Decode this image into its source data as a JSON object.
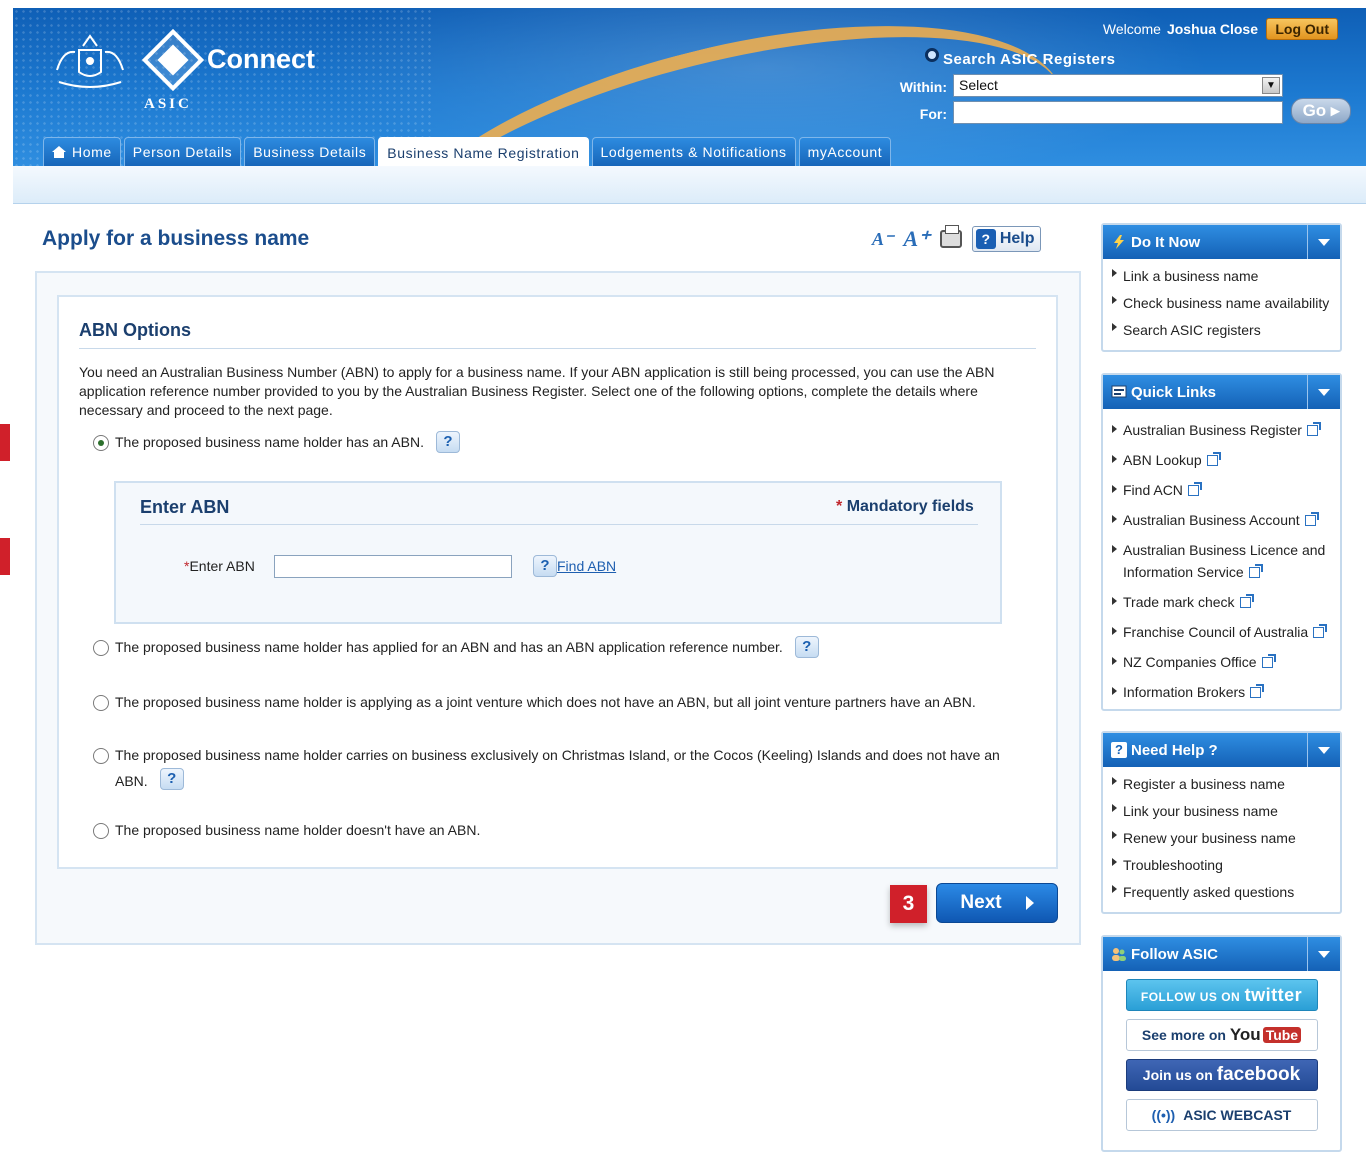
{
  "brand": {
    "name": "Connect",
    "sub": "ASIC"
  },
  "header": {
    "welcome_label": "Welcome",
    "user_name": "Joshua Close",
    "logout_label": "Log Out",
    "search_title": "Search ASIC Registers",
    "within_label": "Within:",
    "within_value": "Select",
    "for_label": "For:",
    "go_label": "Go"
  },
  "tabs": [
    {
      "label": "Home",
      "active": false
    },
    {
      "label": "Person Details",
      "active": false
    },
    {
      "label": "Business Details",
      "active": false
    },
    {
      "label": "Business Name Registration",
      "active": true
    },
    {
      "label": "Lodgements & Notifications",
      "active": false
    },
    {
      "label": "myAccount",
      "active": false
    }
  ],
  "main": {
    "page_title": "Apply for a business name",
    "help_label": "Help",
    "section_title": "ABN Options",
    "intro": "You need an Australian Business Number (ABN) to apply for a business name. If your ABN application is still being processed, you can use the ABN application reference number provided to you by the Australian Business Register. Select one of the following options, complete the details where necessary and proceed to the next page.",
    "options": [
      {
        "label": "The proposed business name holder has an ABN.",
        "checked": true
      },
      {
        "label": "The proposed business name holder has applied for an ABN and has an ABN application reference number.",
        "checked": false
      },
      {
        "label": "The proposed business name holder is applying as a joint venture which does not have an ABN, but all joint venture partners have an ABN.",
        "checked": false
      },
      {
        "label": "The proposed business name holder carries on business exclusively on Christmas Island, or the Cocos (Keeling) Islands and does not have an ABN.",
        "checked": false
      },
      {
        "label": "The proposed business name holder doesn't have an ABN.",
        "checked": false
      }
    ],
    "abn_box": {
      "title": "Enter ABN",
      "mandatory_star": "*",
      "mandatory_label": "Mandatory fields",
      "field_label": "Enter ABN",
      "field_value": "",
      "find_link": "Find ABN"
    },
    "next_label": "Next",
    "step_badge": "3"
  },
  "sidebar": {
    "do_it_now": {
      "title": "Do It Now",
      "items": [
        "Link a business name",
        "Check business name availability",
        "Search ASIC registers"
      ]
    },
    "quick_links": {
      "title": "Quick Links",
      "items": [
        "Australian Business Register",
        "ABN Lookup",
        "Find ACN",
        "Australian Business Account",
        "Australian Business Licence and Information Service",
        "Trade mark check",
        "Franchise Council of Australia",
        "NZ Companies Office",
        "Information Brokers"
      ]
    },
    "need_help": {
      "title": "Need Help ?",
      "items": [
        "Register a business name",
        "Link your business name",
        "Renew your business name",
        "Troubleshooting",
        "Frequently asked questions"
      ]
    },
    "follow": {
      "title": "Follow ASIC",
      "twitter_prefix": "FOLLOW US ON",
      "twitter_brand": "twitter",
      "youtube_prefix": "See more on",
      "youtube_you": "You",
      "youtube_tube": "Tube",
      "facebook_prefix": "Join us on",
      "facebook_brand": "facebook",
      "webcast": "ASIC WEBCAST"
    }
  },
  "colors": {
    "brand_blue": "#1766b9",
    "accent_orange": "#e2941f",
    "badge_red": "#d0202a"
  }
}
